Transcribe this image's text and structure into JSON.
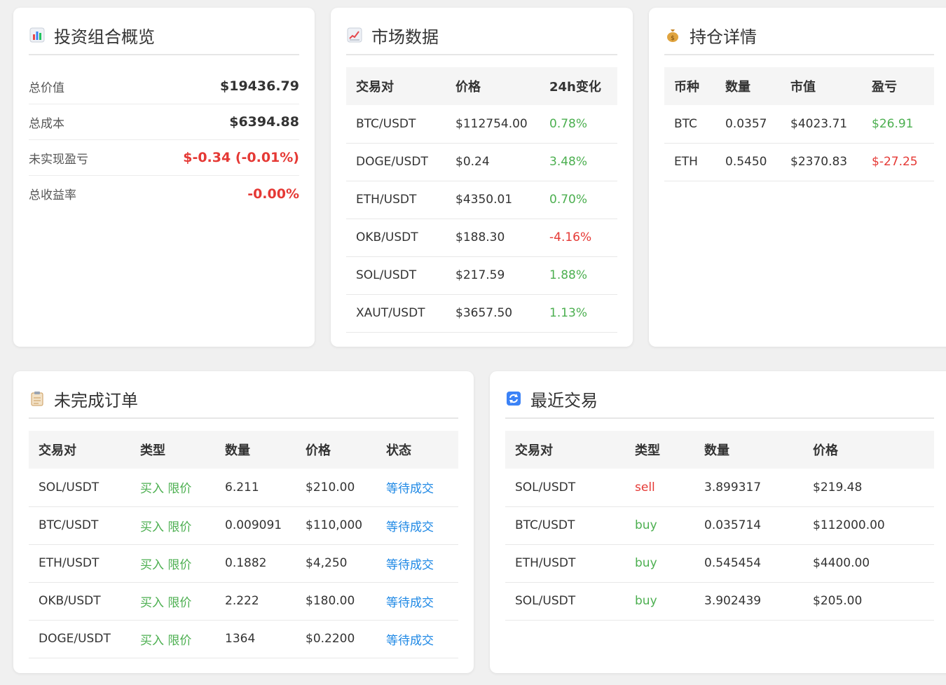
{
  "overview": {
    "title": "投资组合概览",
    "icon": "bar-chart-icon",
    "rows": [
      {
        "label": "总价值",
        "value": "$19436.79"
      },
      {
        "label": "总成本",
        "value": "$6394.88"
      },
      {
        "label": "未实现盈亏",
        "value": "$-0.34 (-0.01%)"
      },
      {
        "label": "总收益率",
        "value": "-0.00%"
      }
    ]
  },
  "market": {
    "title": "市场数据",
    "icon": "line-chart-icon",
    "headers": [
      "交易对",
      "价格",
      "24h变化"
    ],
    "rows": [
      {
        "pair": "BTC/USDT",
        "price": "$112754.00",
        "change": "0.78%"
      },
      {
        "pair": "DOGE/USDT",
        "price": "$0.24",
        "change": "3.48%"
      },
      {
        "pair": "ETH/USDT",
        "price": "$4350.01",
        "change": "0.70%"
      },
      {
        "pair": "OKB/USDT",
        "price": "$188.30",
        "change": "-4.16%"
      },
      {
        "pair": "SOL/USDT",
        "price": "$217.59",
        "change": "1.88%"
      },
      {
        "pair": "XAUT/USDT",
        "price": "$3657.50",
        "change": "1.13%"
      }
    ]
  },
  "holdings": {
    "title": "持仓详情",
    "icon": "money-bag-icon",
    "headers": [
      "币种",
      "数量",
      "市值",
      "盈亏"
    ],
    "rows": [
      {
        "coin": "BTC",
        "qty": "0.0357",
        "value": "$4023.71",
        "pnl": "$26.91"
      },
      {
        "coin": "ETH",
        "qty": "0.5450",
        "value": "$2370.83",
        "pnl": "$-27.25"
      }
    ]
  },
  "orders": {
    "title": "未完成订单",
    "icon": "clipboard-icon",
    "headers": [
      "交易对",
      "类型",
      "数量",
      "价格",
      "状态"
    ],
    "rows": [
      {
        "pair": "SOL/USDT",
        "type": "买入 限价",
        "qty": "6.211",
        "price": "$210.00",
        "status": "等待成交"
      },
      {
        "pair": "BTC/USDT",
        "type": "买入 限价",
        "qty": "0.009091",
        "price": "$110,000",
        "status": "等待成交"
      },
      {
        "pair": "ETH/USDT",
        "type": "买入 限价",
        "qty": "0.1882",
        "price": "$4,250",
        "status": "等待成交"
      },
      {
        "pair": "OKB/USDT",
        "type": "买入 限价",
        "qty": "2.222",
        "price": "$180.00",
        "status": "等待成交"
      },
      {
        "pair": "DOGE/USDT",
        "type": "买入 限价",
        "qty": "1364",
        "price": "$0.2200",
        "status": "等待成交"
      }
    ]
  },
  "trades": {
    "title": "最近交易",
    "icon": "refresh-icon",
    "headers": [
      "交易对",
      "类型",
      "数量",
      "价格"
    ],
    "rows": [
      {
        "pair": "SOL/USDT",
        "type": "sell",
        "qty": "3.899317",
        "price": "$219.48"
      },
      {
        "pair": "BTC/USDT",
        "type": "buy",
        "qty": "0.035714",
        "price": "$112000.00"
      },
      {
        "pair": "ETH/USDT",
        "type": "buy",
        "qty": "0.545454",
        "price": "$4400.00"
      },
      {
        "pair": "SOL/USDT",
        "type": "buy",
        "qty": "3.902439",
        "price": "$205.00"
      }
    ]
  },
  "colors": {
    "positive": "#4caf50",
    "negative": "#e53935",
    "link": "#1e88e5"
  }
}
